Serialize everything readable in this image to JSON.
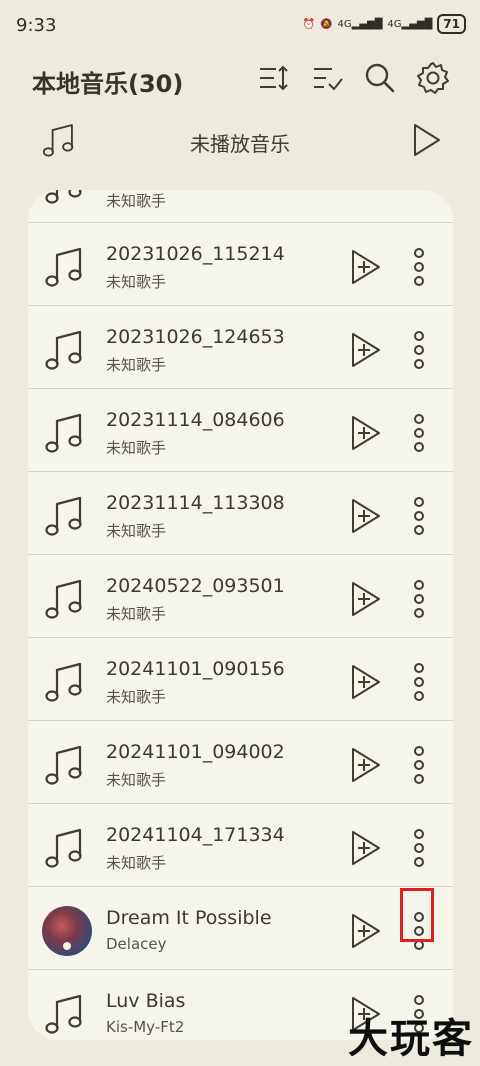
{
  "status_bar": {
    "time": "9:33",
    "signal_1": "4G",
    "signal_2": "4G",
    "battery": "71"
  },
  "header": {
    "title": "本地音乐(30)",
    "icons": [
      "sort-icon",
      "multi-select-icon",
      "search-icon",
      "settings-icon"
    ]
  },
  "unplayed": {
    "label": "未播放音乐",
    "icons": [
      "music-note-icon",
      "play-icon"
    ]
  },
  "songs": [
    {
      "title": "",
      "artist": "未知歌手",
      "thumb": "music-note-icon"
    },
    {
      "title": "20231026_115214",
      "artist": "未知歌手",
      "thumb": "music-note-icon"
    },
    {
      "title": "20231026_124653",
      "artist": "未知歌手",
      "thumb": "music-note-icon"
    },
    {
      "title": "20231114_084606",
      "artist": "未知歌手",
      "thumb": "music-note-icon"
    },
    {
      "title": "20231114_113308",
      "artist": "未知歌手",
      "thumb": "music-note-icon"
    },
    {
      "title": "20240522_093501",
      "artist": "未知歌手",
      "thumb": "music-note-icon"
    },
    {
      "title": "20241101_090156",
      "artist": "未知歌手",
      "thumb": "music-note-icon"
    },
    {
      "title": "20241101_094002",
      "artist": "未知歌手",
      "thumb": "music-note-icon"
    },
    {
      "title": "20241104_171334",
      "artist": "未知歌手",
      "thumb": "music-note-icon"
    },
    {
      "title": "Dream It Possible",
      "artist": "Delacey",
      "thumb": "album-art"
    },
    {
      "title": "Luv Bias",
      "artist": "Kis-My-Ft2",
      "thumb": "music-note-icon"
    }
  ],
  "colors": {
    "background": "#ecebdd",
    "card": "#f6f5ec",
    "highlight": "#e02020"
  },
  "watermark": "大玩客"
}
